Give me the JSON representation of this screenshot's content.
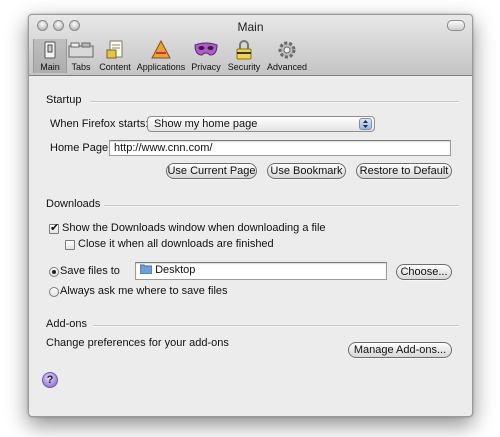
{
  "window": {
    "title": "Main"
  },
  "toolbar": {
    "items": [
      {
        "label": "Main",
        "icon": "main-switch-icon",
        "selected": true
      },
      {
        "label": "Tabs",
        "icon": "tabs-icon",
        "selected": false
      },
      {
        "label": "Content",
        "icon": "content-icon",
        "selected": false
      },
      {
        "label": "Applications",
        "icon": "applications-icon",
        "selected": false
      },
      {
        "label": "Privacy",
        "icon": "privacy-mask-icon",
        "selected": false
      },
      {
        "label": "Security",
        "icon": "security-lock-icon",
        "selected": false
      },
      {
        "label": "Advanced",
        "icon": "advanced-gear-icon",
        "selected": false
      }
    ]
  },
  "startup": {
    "heading": "Startup",
    "when_label": "When Firefox starts:",
    "when_value": "Show my home page",
    "home_label": "Home Page:",
    "home_value": "http://www.cnn.com/",
    "use_current_button": "Use Current Page",
    "use_bookmark_button": "Use Bookmark",
    "restore_default_button": "Restore to Default"
  },
  "downloads": {
    "heading": "Downloads",
    "show_window_label": "Show the Downloads window when downloading a file",
    "show_window_checked": true,
    "close_when_done_label": "Close it when all downloads are finished",
    "close_when_done_checked": false,
    "save_files_label": "Save files to",
    "save_files_selected": true,
    "save_location": "Desktop",
    "choose_button": "Choose...",
    "always_ask_label": "Always ask me where to save files",
    "always_ask_selected": false
  },
  "addons": {
    "heading": "Add-ons",
    "description": "Change preferences for your add-ons",
    "manage_button": "Manage Add-ons..."
  },
  "help": {
    "label": "?"
  },
  "colors": {
    "window_bg": "#ececec",
    "help_purple": "#9a7fd6",
    "folder_blue": "#6f9fd8"
  }
}
